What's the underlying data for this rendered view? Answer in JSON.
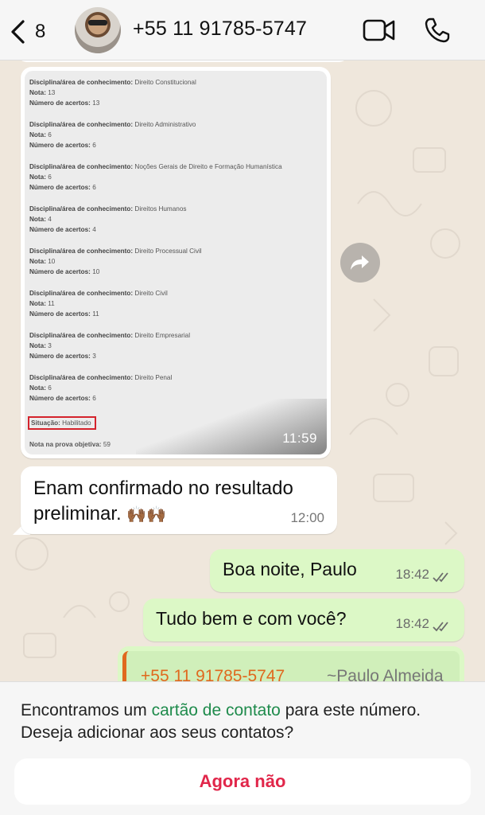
{
  "header": {
    "back_count": "8",
    "title": "+55 11 91785-5747"
  },
  "image_message": {
    "blocks": [
      {
        "disciplina_label": "Disciplina/área de conhecimento:",
        "disciplina": "Direito Constitucional",
        "nota_label": "Nota:",
        "nota": "13",
        "acertos_label": "Número de acertos:",
        "acertos": "13"
      },
      {
        "disciplina_label": "Disciplina/área de conhecimento:",
        "disciplina": "Direito Administrativo",
        "nota_label": "Nota:",
        "nota": "6",
        "acertos_label": "Número de acertos:",
        "acertos": "6"
      },
      {
        "disciplina_label": "Disciplina/área de conhecimento:",
        "disciplina": "Noções Gerais de Direito e Formação Humanística",
        "nota_label": "Nota:",
        "nota": "6",
        "acertos_label": "Número de acertos:",
        "acertos": "6"
      },
      {
        "disciplina_label": "Disciplina/área de conhecimento:",
        "disciplina": "Direitos Humanos",
        "nota_label": "Nota:",
        "nota": "4",
        "acertos_label": "Número de acertos:",
        "acertos": "4"
      },
      {
        "disciplina_label": "Disciplina/área de conhecimento:",
        "disciplina": "Direito Processual Civil",
        "nota_label": "Nota:",
        "nota": "10",
        "acertos_label": "Número de acertos:",
        "acertos": "10"
      },
      {
        "disciplina_label": "Disciplina/área de conhecimento:",
        "disciplina": "Direito Civil",
        "nota_label": "Nota:",
        "nota": "11",
        "acertos_label": "Número de acertos:",
        "acertos": "11"
      },
      {
        "disciplina_label": "Disciplina/área de conhecimento:",
        "disciplina": "Direito Empresarial",
        "nota_label": "Nota:",
        "nota": "3",
        "acertos_label": "Número de acertos:",
        "acertos": "3"
      },
      {
        "disciplina_label": "Disciplina/área de conhecimento:",
        "disciplina": "Direito Penal",
        "nota_label": "Nota:",
        "nota": "6",
        "acertos_label": "Número de acertos:",
        "acertos": "6"
      }
    ],
    "situacao_label": "Situação:",
    "situacao": "Habilitado",
    "nota_final_label": "Nota na prova objetiva:",
    "nota_final": "59",
    "time": "11:59"
  },
  "incoming_text": {
    "text": "Enam confirmado no resultado preliminar.",
    "emoji": "🙌🏾🙌🏾",
    "time": "12:00"
  },
  "outgoing": [
    {
      "text": "Boa noite, Paulo",
      "time": "18:42"
    },
    {
      "text": "Tudo bem e com você?",
      "time": "18:42"
    }
  ],
  "contact_card": {
    "number": "+55 11 91785-5747",
    "name": "~Paulo Almeida"
  },
  "sheet": {
    "text_before": "Encontramos um ",
    "link": "cartão de contato",
    "text_after": " para este número. Deseja adicionar aos seus contatos?",
    "button": "Agora não"
  },
  "colors": {
    "outgoing_bubble": "#dcf8c6",
    "contact_accent": "#e0691e",
    "link_green": "#1f8b4c",
    "button_red": "#e1264a"
  }
}
